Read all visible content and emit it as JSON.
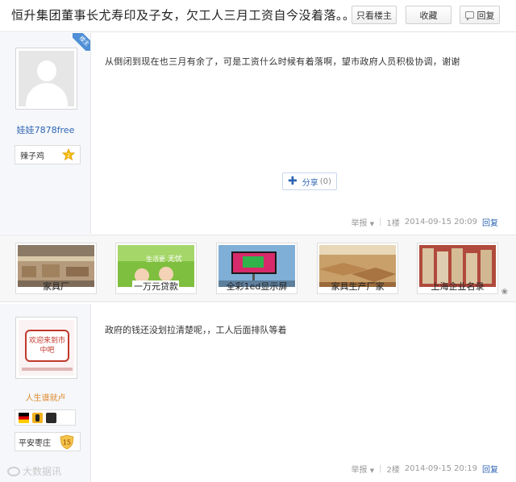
{
  "thread": {
    "title": "恒升集团董事长尤寿印及子女，欠工人三月工资自今没着落。。",
    "only_op_label": "只看楼主",
    "favorite_label": "收藏",
    "reply_label": "回复"
  },
  "posts": [
    {
      "corner_badge": "楼主",
      "username": "娃娃7878free",
      "level_title": "辣子鸡",
      "level_num": "2",
      "content": "从倒闭到现在也三月有余了，可是工资什么时候有着落啊，望市政府人员积极协调，谢谢",
      "share_label": "分享",
      "share_count": "(0)",
      "report_label": "举报",
      "floor": "1楼",
      "datetime": "2014-09-15 20:09",
      "reply_label": "回复"
    },
    {
      "avatar_text": "欢迎来到市中吧",
      "username": "人生谱就卢",
      "level_title": "平安枣庄",
      "level_num": "15",
      "content": "政府的钱还没划拉清楚呢，，工人后面排队等着",
      "report_label": "举报",
      "floor": "2楼",
      "datetime": "2014-09-15 20:19",
      "reply_label": "回复"
    }
  ],
  "ads": [
    {
      "caption": "家具厂"
    },
    {
      "caption": "一万元贷款",
      "overlay_line1": "生活更",
      "overlay_line2": "无忧"
    },
    {
      "caption": "全彩1ed显示屏"
    },
    {
      "caption": "家具生产厂家"
    },
    {
      "caption": "上海企业名录"
    }
  ],
  "watermark": "大数据讯",
  "colors": {
    "link_blue": "#2d64b3",
    "orange_user": "#e08a2e",
    "sidebar_bg": "#f5f7fa",
    "badge_gold": "#f5b800"
  }
}
